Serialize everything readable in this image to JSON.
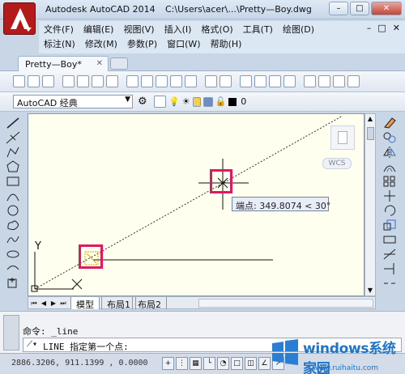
{
  "window": {
    "app_title": "Autodesk AutoCAD 2014",
    "doc_path": "C:\\Users\\acer\\...\\Pretty—Boy.dwg",
    "buttons": [
      "–",
      "□",
      "✕"
    ]
  },
  "menubar": {
    "row1": [
      "文件(F)",
      "编辑(E)",
      "视图(V)",
      "插入(I)",
      "格式(O)",
      "工具(T)",
      "绘图(D)"
    ],
    "row2": [
      "标注(N)",
      "修改(M)",
      "参数(P)",
      "窗口(W)",
      "帮助(H)"
    ],
    "mdi_buttons": [
      "–",
      "□",
      "✕"
    ]
  },
  "tabs": {
    "active": "Pretty—Boy*",
    "close": "✕"
  },
  "toolbar2": {
    "workspace": "AutoCAD 经典",
    "layer_value": "0"
  },
  "canvas": {
    "tooltip": "端点: 349.8074 < 30°",
    "ucs_y": "Y",
    "wcs_label": "WCS"
  },
  "layout_tabs": [
    "模型",
    "布局1",
    "布局2"
  ],
  "command": {
    "history_line": "命令: _line",
    "prompt": "LINE 指定第一个点:"
  },
  "status": {
    "coords": "2886.3206, 911.1399 , 0.0000"
  },
  "watermark": {
    "title": "windows系统家园",
    "sub": "www.ruihaitu.com"
  },
  "colors": {
    "canvas_bg": "#fffff0",
    "highlight": "#e0195f",
    "app_logo": "#b51a1a",
    "watermark": "#1d74c8"
  }
}
